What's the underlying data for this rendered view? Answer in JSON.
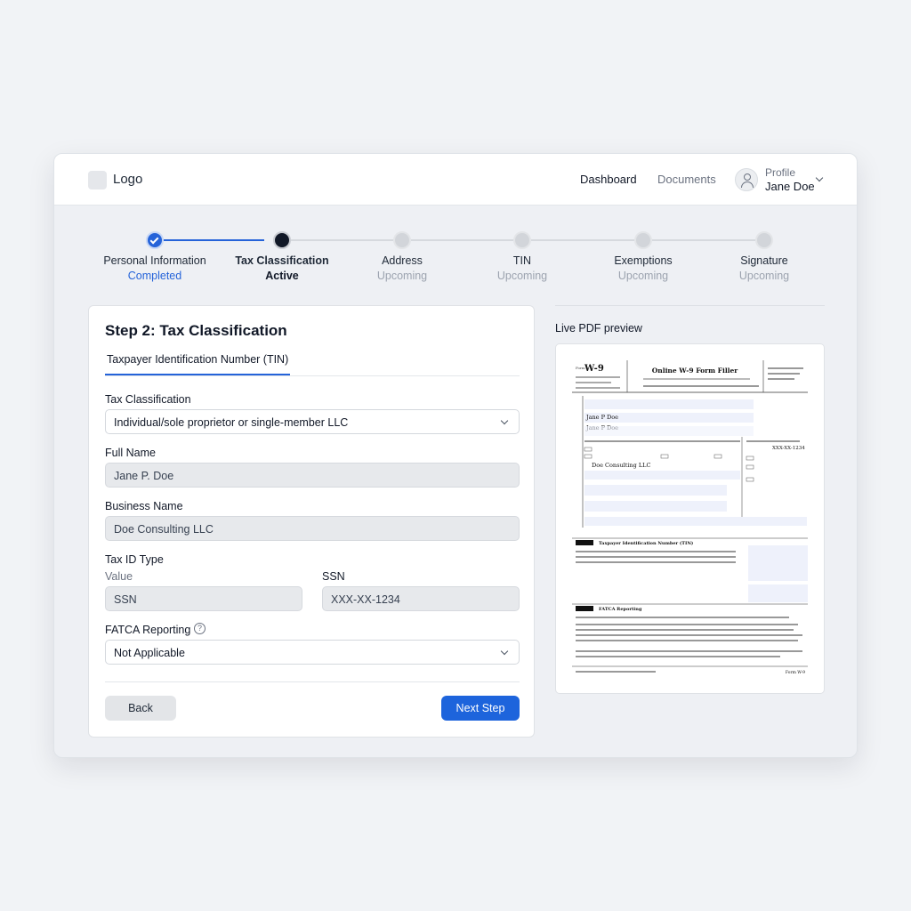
{
  "header": {
    "logo_text": "Logo",
    "nav": [
      "Dashboard",
      "Documents"
    ],
    "profile_label": "Profile",
    "profile_name": "Jane Doe"
  },
  "stepper": [
    {
      "label": "Personal Information",
      "status": "Completed"
    },
    {
      "label": "Tax Classification",
      "status": "Active"
    },
    {
      "label": "Address",
      "status": "Upcoming"
    },
    {
      "label": "TIN",
      "status": "Upcoming"
    },
    {
      "label": "Exemptions",
      "status": "Upcoming"
    },
    {
      "label": "Signature",
      "status": "Upcoming"
    }
  ],
  "form": {
    "title": "Step 2: Tax Classification",
    "tab": "Taxpayer Identification Number (TIN)",
    "tax_classification_label": "Tax Classification",
    "tax_classification_value": "Individual/sole proprietor or single-member LLC",
    "full_name_label": "Full Name",
    "full_name_value": "Jane P. Doe",
    "business_name_label": "Business Name",
    "business_name_value": "Doe Consulting LLC",
    "tax_id_type_label": "Tax ID Type",
    "value_sublabel": "Value",
    "tax_id_type_value": "SSN",
    "ssn_label": "SSN",
    "ssn_value": "XXX-XX-1234",
    "fatca_label": "FATCA Reporting",
    "fatca_help": "?",
    "fatca_value": "Not Applicable",
    "back_label": "Back",
    "next_label": "Next Step"
  },
  "preview": {
    "label": "Live PDF preview",
    "pdf": {
      "form_id": "W-9",
      "title": "Online W-9 Form Filler",
      "name": "Jane P Doe",
      "business": "Doe Consulting LLC",
      "tin": "XXX-XX-1234",
      "part1": "Taxpayer Identification Number (TIN)",
      "part2": "FATCA Reporting",
      "footer": "Form W-9"
    }
  },
  "colors": {
    "accent": "#2563d9",
    "active_step": "#111827",
    "upcoming_step": "#d2d5da"
  }
}
